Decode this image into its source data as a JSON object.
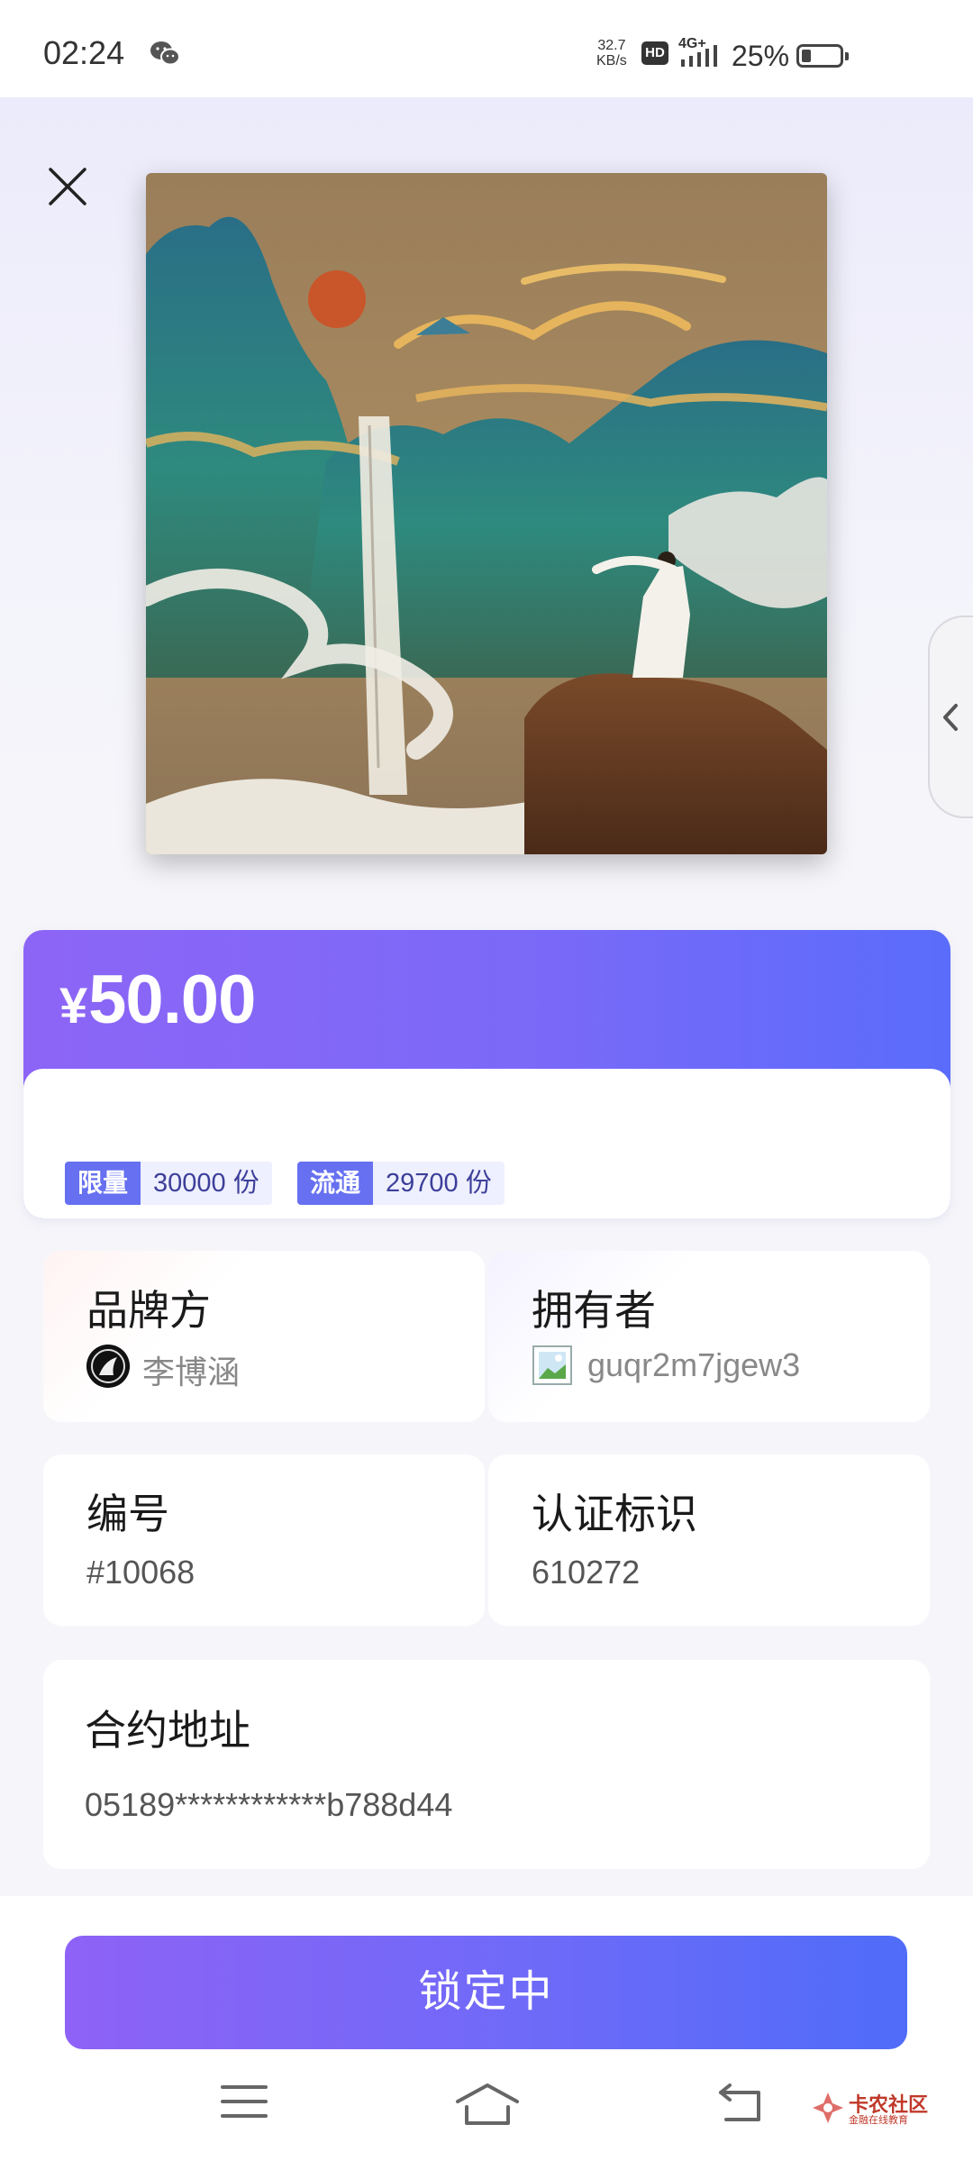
{
  "status_bar": {
    "time": "02:24",
    "net_speed_value": "32.7",
    "net_speed_unit": "KB/s",
    "hd_label": "HD",
    "network_type": "4G+",
    "battery_percent": "25%",
    "battery_level": 0.25
  },
  "icons": {
    "close": "close-icon",
    "side_tab": "chevron-left-icon",
    "nav_menu": "menu-icon",
    "nav_home": "home-icon",
    "nav_back": "back-icon"
  },
  "price": {
    "currency": "¥",
    "amount": "50.00"
  },
  "tags": {
    "limit_label": "限量",
    "limit_value": "30000 份",
    "circulation_label": "流通",
    "circulation_value": "29700 份"
  },
  "info": {
    "brand_title": "品牌方",
    "brand_name": "李博涵",
    "owner_title": "拥有者",
    "owner_name": "guqr2m7jgew3",
    "number_title": "编号",
    "number_value": "#10068",
    "cert_title": "认证标识",
    "cert_value": "610272",
    "contract_title": "合约地址",
    "contract_value": "05189************b788d44"
  },
  "action": {
    "button_label": "锁定中"
  },
  "watermark": {
    "name": "卡农社区",
    "tagline": "金融在线教育"
  },
  "colors": {
    "accent_start": "#8d65f6",
    "accent_end": "#4f6cf9",
    "tag_label_bg": "#6670f0"
  }
}
